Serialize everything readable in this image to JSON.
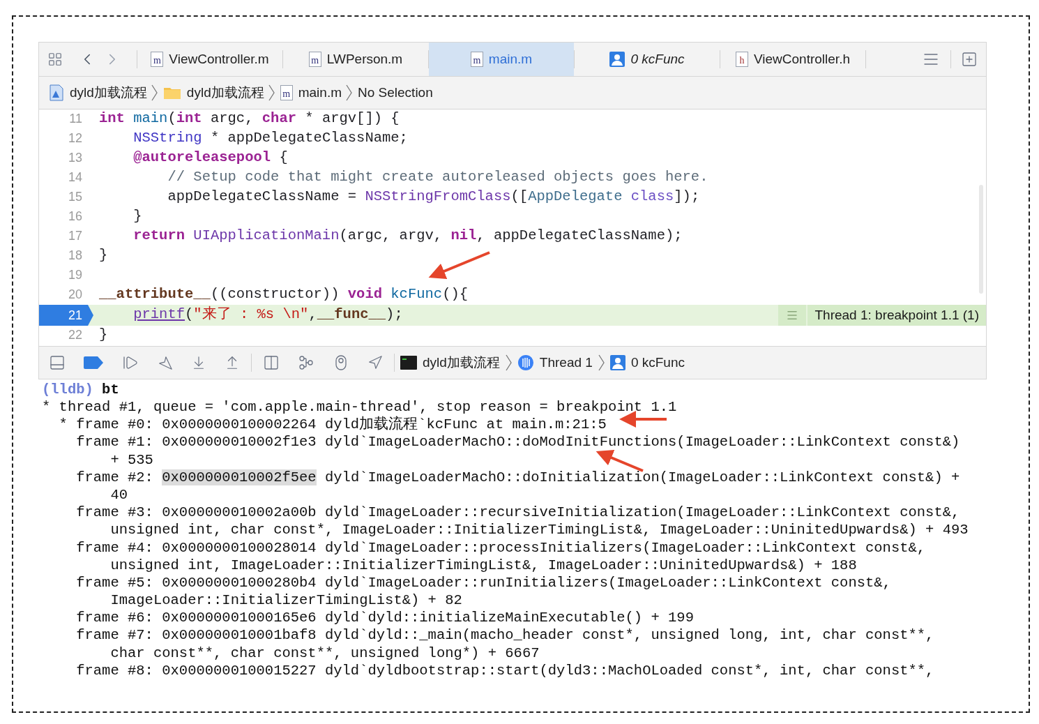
{
  "tabs": [
    {
      "label": "ViewController.m",
      "kind": "file",
      "icon_letter": "m",
      "selected": false
    },
    {
      "label": "LWPerson.m",
      "kind": "file",
      "icon_letter": "m",
      "selected": false
    },
    {
      "label": "main.m",
      "kind": "file",
      "icon_letter": "m",
      "selected": true
    },
    {
      "label": "0 kcFunc",
      "kind": "symbol",
      "selected": false
    },
    {
      "label": "ViewController.h",
      "kind": "header",
      "icon_letter": "h",
      "selected": false
    }
  ],
  "breadcrumb": [
    {
      "label": "dyld加载流程",
      "kind": "project"
    },
    {
      "label": "dyld加载流程",
      "kind": "folder"
    },
    {
      "label": "main.m",
      "kind": "file",
      "icon_letter": "m"
    },
    {
      "label": "No Selection",
      "kind": "plain"
    }
  ],
  "code_lines": [
    {
      "number": "11",
      "breakpoint": false,
      "segments": [
        {
          "text": "int",
          "kind": "keyword"
        },
        {
          "text": " main",
          "kind": "decl"
        },
        {
          "text": "(",
          "kind": "plain"
        },
        {
          "text": "int",
          "kind": "keyword"
        },
        {
          "text": " argc, ",
          "kind": "plain"
        },
        {
          "text": "char",
          "kind": "keyword"
        },
        {
          "text": " * argv[]) {",
          "kind": "plain"
        }
      ]
    },
    {
      "number": "12",
      "breakpoint": false,
      "segments": [
        {
          "text": "    NSString",
          "kind": "type"
        },
        {
          "text": " * appDelegateClassName;",
          "kind": "plain"
        }
      ]
    },
    {
      "number": "13",
      "breakpoint": false,
      "segments": [
        {
          "text": "    @autoreleasepool",
          "kind": "keyword"
        },
        {
          "text": " {",
          "kind": "plain"
        }
      ]
    },
    {
      "number": "14",
      "breakpoint": false,
      "segments": [
        {
          "text": "        // Setup code that might create autoreleased objects goes here.",
          "kind": "comment"
        }
      ]
    },
    {
      "number": "15",
      "breakpoint": false,
      "segments": [
        {
          "text": "        appDelegateClassName = ",
          "kind": "plain"
        },
        {
          "text": "NSStringFromClass",
          "kind": "call"
        },
        {
          "text": "([",
          "kind": "plain"
        },
        {
          "text": "AppDelegate",
          "kind": "classref"
        },
        {
          "text": " class",
          "kind": "objc"
        },
        {
          "text": "]);",
          "kind": "plain"
        }
      ]
    },
    {
      "number": "16",
      "breakpoint": false,
      "segments": [
        {
          "text": "    }",
          "kind": "plain"
        }
      ]
    },
    {
      "number": "17",
      "breakpoint": false,
      "segments": [
        {
          "text": "    return",
          "kind": "keyword"
        },
        {
          "text": " UIApplicationMain",
          "kind": "call"
        },
        {
          "text": "(argc, argv, ",
          "kind": "plain"
        },
        {
          "text": "nil",
          "kind": "keyword"
        },
        {
          "text": ", appDelegateClassName);",
          "kind": "plain"
        }
      ]
    },
    {
      "number": "18",
      "breakpoint": false,
      "segments": [
        {
          "text": "}",
          "kind": "plain"
        }
      ]
    },
    {
      "number": "19",
      "breakpoint": false
    },
    {
      "number": "20",
      "breakpoint": false,
      "segments": [
        {
          "text": "__attribute__",
          "kind": "macro"
        },
        {
          "text": "((constructor)) ",
          "kind": "plain"
        },
        {
          "text": "void",
          "kind": "keyword"
        },
        {
          "text": " kcFunc",
          "kind": "decl"
        },
        {
          "text": "(){",
          "kind": "plain"
        }
      ]
    },
    {
      "number": "21",
      "breakpoint": true,
      "annotation": "Thread 1: breakpoint 1.1 (1)",
      "segments": [
        {
          "text": "    printf",
          "kind": "link"
        },
        {
          "text": "(",
          "kind": "plain"
        },
        {
          "text": "\"来了 : %s \\n\"",
          "kind": "string"
        },
        {
          "text": ",",
          "kind": "plain"
        },
        {
          "text": "__func__",
          "kind": "macro"
        },
        {
          "text": ");",
          "kind": "plain"
        }
      ]
    },
    {
      "number": "22",
      "breakpoint": false,
      "segments": [
        {
          "text": "}",
          "kind": "plain"
        }
      ]
    }
  ],
  "debug_bar": {
    "breakpoints_active": true,
    "path": [
      {
        "label": "dyld加载流程",
        "kind": "process"
      },
      {
        "label": "Thread 1",
        "kind": "thread"
      },
      {
        "label": "0 kcFunc",
        "kind": "frame"
      }
    ]
  },
  "console": [
    {
      "segments": [
        {
          "text": "(lldb)",
          "kind": "prompt"
        },
        {
          "text": " bt",
          "kind": "command"
        }
      ]
    },
    {
      "segments": [
        {
          "text": "* thread #1, queue = 'com.apple.main-thread', stop reason = breakpoint 1.1",
          "kind": "plain"
        }
      ]
    },
    {
      "segments": [
        {
          "text": "  * frame #0: 0x0000000100002264 dyld加载流程`kcFunc at main.m:21:5",
          "kind": "plain"
        }
      ]
    },
    {
      "segments": [
        {
          "text": "    frame #1: 0x000000010002f1e3 dyld`ImageLoaderMachO::doModInitFunctions(ImageLoader::LinkContext const&)",
          "kind": "plain"
        }
      ]
    },
    {
      "segments": [
        {
          "text": "        + 535",
          "kind": "plain"
        }
      ]
    },
    {
      "segments": [
        {
          "text": "    frame #2: ",
          "kind": "plain"
        },
        {
          "text": "0x000000010002f5ee",
          "kind": "highlight"
        },
        {
          "text": " dyld`ImageLoaderMachO::doInitialization(ImageLoader::LinkContext const&) +",
          "kind": "plain"
        }
      ]
    },
    {
      "segments": [
        {
          "text": "        40",
          "kind": "plain"
        }
      ]
    },
    {
      "segments": [
        {
          "text": "    frame #3: 0x000000010002a00b dyld`ImageLoader::recursiveInitialization(ImageLoader::LinkContext const&,",
          "kind": "plain"
        }
      ]
    },
    {
      "segments": [
        {
          "text": "        unsigned int, char const*, ImageLoader::InitializerTimingList&, ImageLoader::UninitedUpwards&) + 493",
          "kind": "plain"
        }
      ]
    },
    {
      "segments": [
        {
          "text": "    frame #4: 0x0000000100028014 dyld`ImageLoader::processInitializers(ImageLoader::LinkContext const&,",
          "kind": "plain"
        }
      ]
    },
    {
      "segments": [
        {
          "text": "        unsigned int, ImageLoader::InitializerTimingList&, ImageLoader::UninitedUpwards&) + 188",
          "kind": "plain"
        }
      ]
    },
    {
      "segments": [
        {
          "text": "    frame #5: 0x00000001000280b4 dyld`ImageLoader::runInitializers(ImageLoader::LinkContext const&,",
          "kind": "plain"
        }
      ]
    },
    {
      "segments": [
        {
          "text": "        ImageLoader::InitializerTimingList&) + 82",
          "kind": "plain"
        }
      ]
    },
    {
      "segments": [
        {
          "text": "    frame #6: 0x00000001000165e6 dyld`dyld::initializeMainExecutable() + 199",
          "kind": "plain"
        }
      ]
    },
    {
      "segments": [
        {
          "text": "    frame #7: 0x000000010001baf8 dyld`dyld::_main(macho_header const*, unsigned long, int, char const**,",
          "kind": "plain"
        }
      ]
    },
    {
      "segments": [
        {
          "text": "        char const**, char const**, unsigned long*) + 6667",
          "kind": "plain"
        }
      ]
    },
    {
      "segments": [
        {
          "text": "    frame #8: 0x0000000100015227 dyld`dyldbootstrap::start(dyld3::MachOLoaded const*, int, char const**,",
          "kind": "plain"
        }
      ]
    }
  ]
}
